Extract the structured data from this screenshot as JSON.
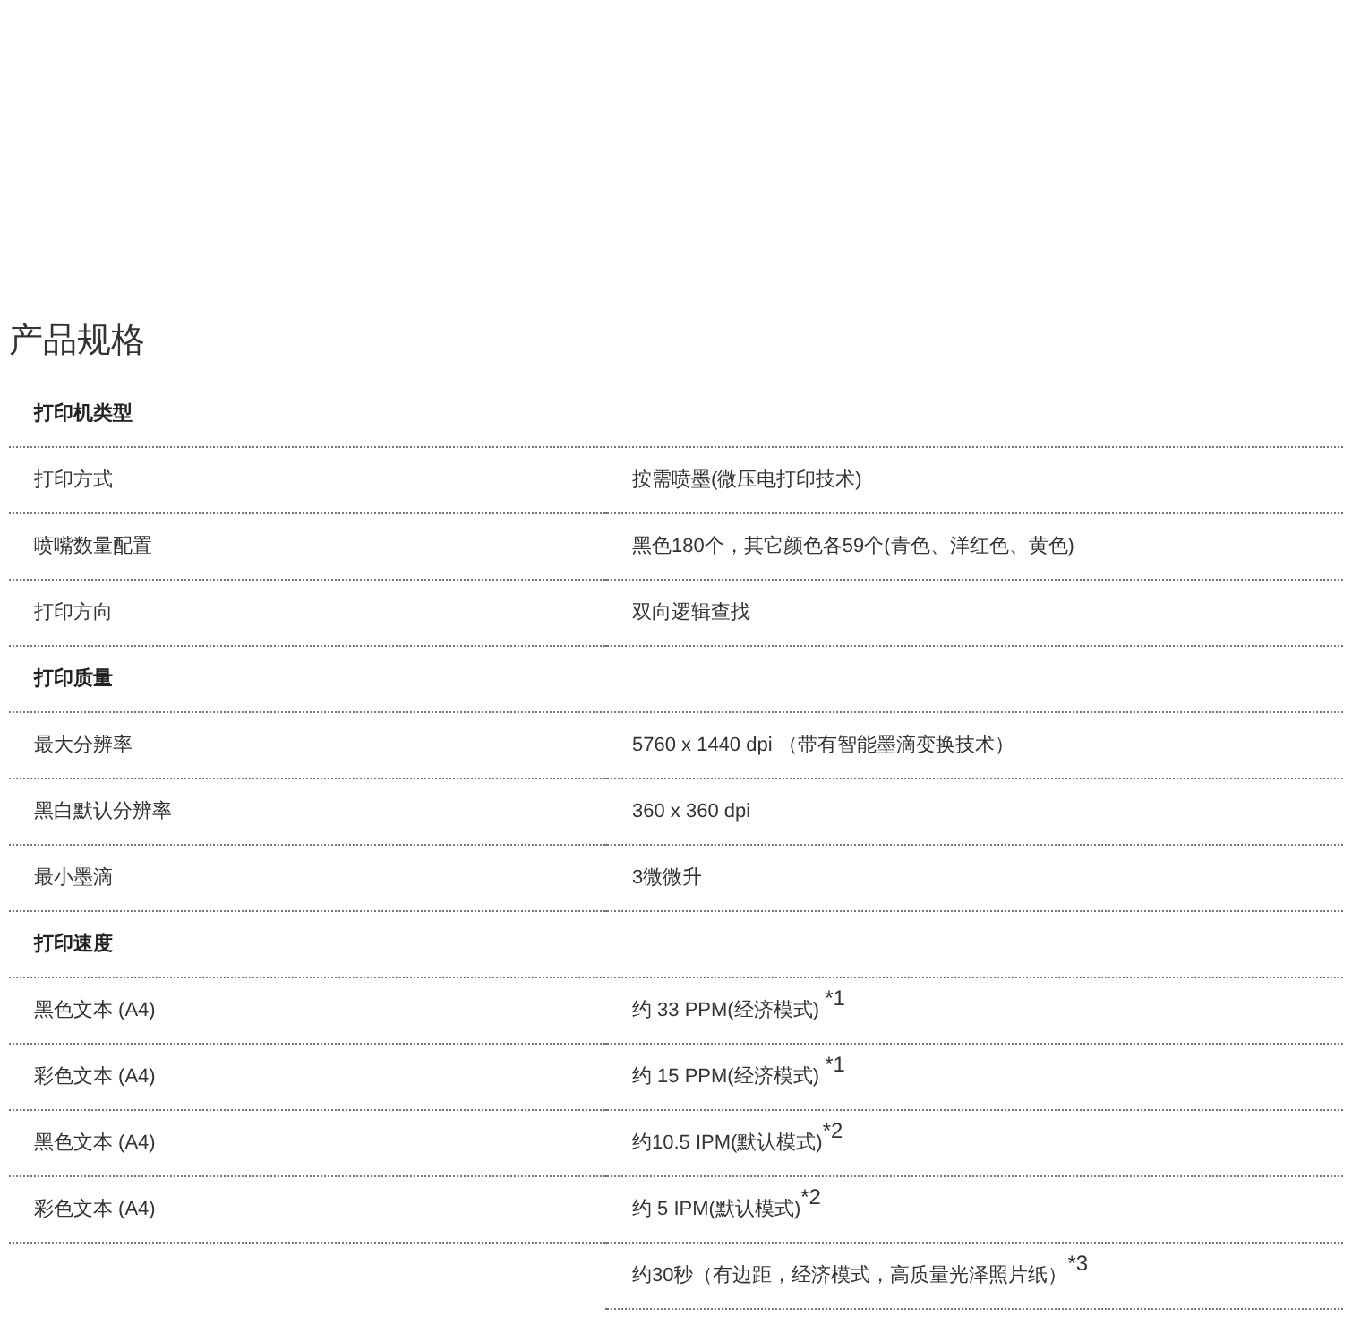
{
  "title": "产品规格",
  "rows": [
    {
      "kind": "section",
      "label": "打印机类型"
    },
    {
      "kind": "spec",
      "label": "打印方式",
      "value": "按需喷墨(微压电打印技术)"
    },
    {
      "kind": "spec",
      "label": "喷嘴数量配置",
      "value": "黑色180个，其它颜色各59个(青色、洋红色、黄色)"
    },
    {
      "kind": "spec",
      "label": "打印方向",
      "value": "双向逻辑查找"
    },
    {
      "kind": "section",
      "label": "打印质量"
    },
    {
      "kind": "spec",
      "label": "最大分辨率",
      "value": "5760 x 1440 dpi （带有智能墨滴变换技术）"
    },
    {
      "kind": "spec",
      "label": "黑白默认分辨率",
      "value": "360 x 360 dpi"
    },
    {
      "kind": "spec",
      "label": "最小墨滴",
      "value": "3微微升"
    },
    {
      "kind": "section",
      "label": "打印速度"
    },
    {
      "kind": "spec",
      "label": "黑色文本 (A4)",
      "value": "约 33 PPM(经济模式) $^{*1}$"
    },
    {
      "kind": "spec",
      "label": "彩色文本 (A4)",
      "value": "约 15 PPM(经济模式) $^{*1}$"
    },
    {
      "kind": "spec",
      "label": "黑色文本 (A4)",
      "value": "约10.5 IPM(默认模式)$^{*2}$"
    },
    {
      "kind": "spec",
      "label": "彩色文本 (A4)",
      "value": "约 5 IPM(默认模式)$^{*2}$"
    },
    {
      "kind": "spec",
      "value": "约30秒（有边距，经济模式，高质量光泽照片纸）$^{*3}$"
    }
  ]
}
